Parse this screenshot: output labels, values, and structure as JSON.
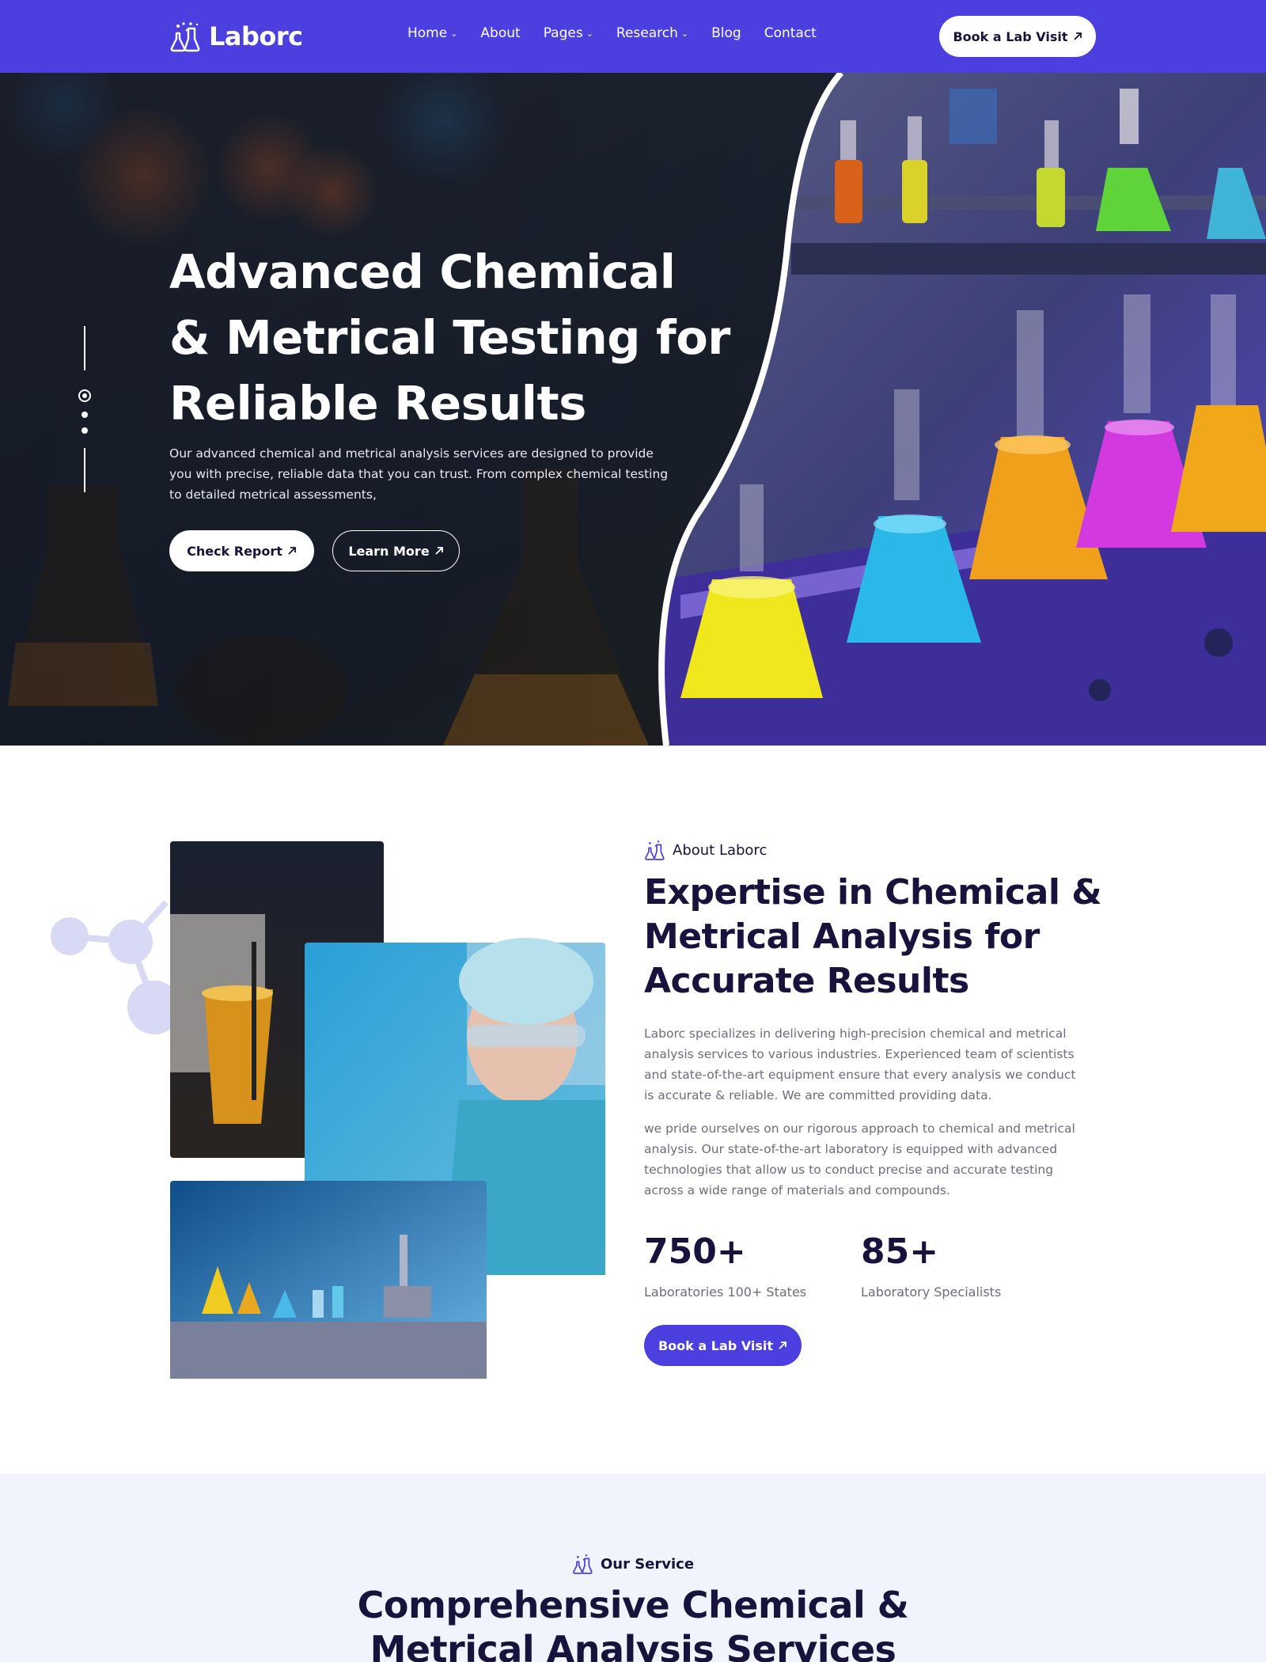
{
  "nav": {
    "logo_text": "Laborc",
    "items": [
      {
        "label": "Home",
        "dropdown": true
      },
      {
        "label": "About",
        "dropdown": false
      },
      {
        "label": "Pages",
        "dropdown": true
      },
      {
        "label": "Research",
        "dropdown": true
      },
      {
        "label": "Blog",
        "dropdown": false
      },
      {
        "label": "Contact",
        "dropdown": false
      }
    ],
    "cta_label": "Book a Lab Visit"
  },
  "hero": {
    "title_lines": [
      "Advanced Chemical",
      "& Metrical Testing for",
      "Reliable Results"
    ],
    "description_lines": [
      "Our advanced chemical and metrical analysis services are designed to provide",
      "you with precise, reliable data that you can trust. From complex chemical testing",
      "to detailed metrical assessments,"
    ],
    "primary_button": "Check Report",
    "secondary_button": "Learn More",
    "slider": {
      "total": 3,
      "active": 1
    }
  },
  "about": {
    "tag": "About Laborc",
    "title_lines": [
      "Expertise in Chemical &",
      "Metrical Analysis for",
      "Accurate Results"
    ],
    "paragraph1_lines": [
      "Laborc specializes in delivering high-precision chemical and metrical",
      "analysis services to various industries. Experienced team of scientists",
      "and state-of-the-art equipment ensure that every analysis we conduct",
      "is accurate & reliable. We are committed providing data."
    ],
    "paragraph2_lines": [
      "we pride ourselves on our rigorous approach to chemical and metrical",
      "analysis. Our state-of-the-art laboratory is equipped with advanced",
      "technologies that allow us to conduct precise and accurate testing",
      "across a wide range of materials and compounds."
    ],
    "stats": [
      {
        "value": "750+",
        "label": "Laboratories 100+ States"
      },
      {
        "value": "85+",
        "label": "Laboratory Specialists"
      }
    ],
    "button": "Book a Lab Visit"
  },
  "services": {
    "tag": "Our Service",
    "title_lines": [
      "Comprehensive Chemical &",
      "Metrical Analysis Services"
    ]
  },
  "colors": {
    "brand": "#4c3fe0",
    "heading": "#17133d",
    "body_text": "#6b6c7e",
    "section_bg": "#f1f3fd"
  },
  "icons": [
    "flask-logo-icon",
    "chevron-down-icon",
    "arrow-up-right-icon",
    "molecule-icon"
  ]
}
